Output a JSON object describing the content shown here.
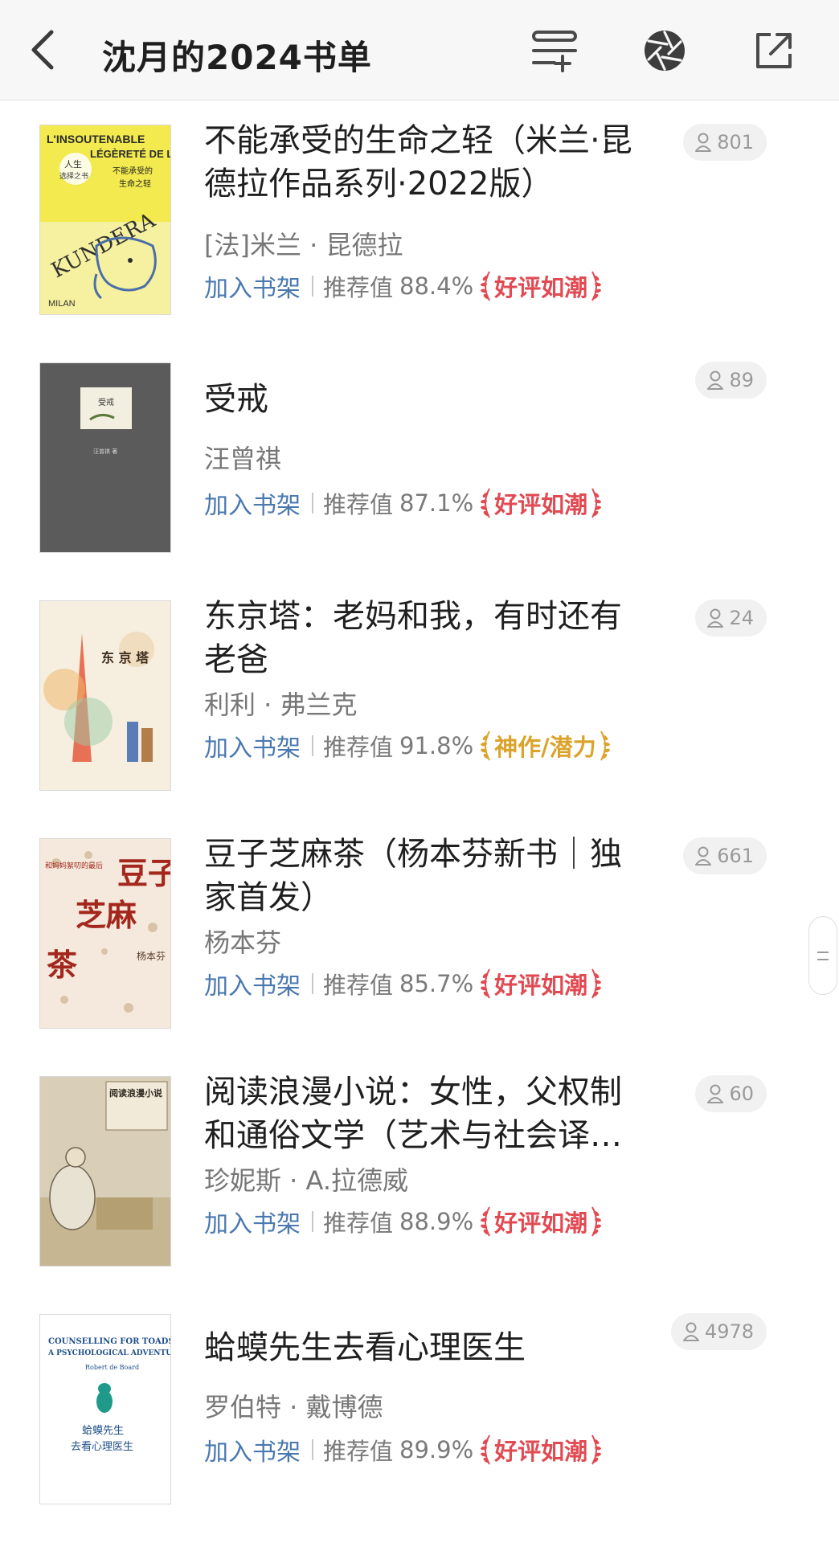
{
  "header": {
    "title": "沈月的2024书单",
    "back_icon": "chevron-left-icon",
    "filter_icon": "filter-add-icon",
    "aperture_icon": "aperture-icon",
    "share_icon": "share-external-icon"
  },
  "actions_common": {
    "add_shelf": "加入书架",
    "rec_label": "推荐值"
  },
  "books": [
    {
      "title": "不能承受的生命之轻（米兰·昆德拉作品系列·2022版）",
      "author": "[法]米兰 · 昆德拉",
      "rec_value": "88.4%",
      "badge": "好评如潮",
      "badge_color": "#e24a52",
      "count": "801",
      "cover_lines": [
        "L'INSOUTENABLE",
        "LÉGÈRETÉ DE L'ÊTRE",
        "人生",
        "选择之书",
        "不能承受的",
        "生命之轻",
        "KUNDERA",
        "MILAN"
      ]
    },
    {
      "title": "受戒",
      "author": "汪曾祺",
      "rec_value": "87.1%",
      "badge": "好评如潮",
      "badge_color": "#e24a52",
      "count": "89",
      "cover_lines": [
        "受戒",
        "汪曾祺 著"
      ]
    },
    {
      "title": "东京塔：老妈和我，有时还有老爸",
      "author": "利利 · 弗兰克",
      "rec_value": "91.8%",
      "badge": "神作/潜力",
      "badge_color": "#dba32a",
      "count": "24",
      "cover_lines": [
        "东 京 塔"
      ]
    },
    {
      "title": "豆子芝麻茶（杨本芬新书｜独家首发）",
      "author": "杨本芬",
      "rec_value": "85.7%",
      "badge": "好评如潮",
      "badge_color": "#e24a52",
      "count": "661",
      "cover_lines": [
        "豆子",
        "芝麻",
        "茶",
        "杨本芬",
        "和妈妈絮叨的最后"
      ]
    },
    {
      "title": "阅读浪漫小说：女性，父权制和通俗文学（艺术与社会译…",
      "author": "珍妮斯 · A.拉德威",
      "rec_value": "88.9%",
      "badge": "好评如潮",
      "badge_color": "#e24a52",
      "count": "60",
      "cover_lines": [
        "阅读浪漫小说"
      ]
    },
    {
      "title": "蛤蟆先生去看心理医生",
      "author": "罗伯特 · 戴博德",
      "rec_value": "89.9%",
      "badge": "好评如潮",
      "badge_color": "#e24a52",
      "count": "4978",
      "cover_lines": [
        "COUNSELLING FOR TOADS:",
        "A PSYCHOLOGICAL ADVENTURE",
        "Robert de Board",
        "蛤蟆先生",
        "去看心理医生"
      ]
    }
  ],
  "icons": {
    "person": "person-icon",
    "laurel": "laurel-icon",
    "scroll": "scroll-handle-icon"
  }
}
